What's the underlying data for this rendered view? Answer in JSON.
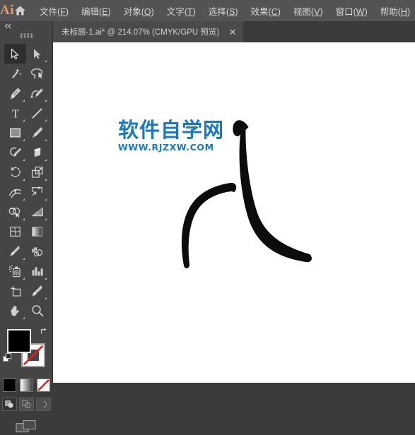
{
  "app": {
    "name": "Ai",
    "logo_color": "#e59b63",
    "home_icon": "home-icon"
  },
  "menubar": {
    "items": [
      {
        "label": "文件",
        "accel": "F"
      },
      {
        "label": "编辑",
        "accel": "E"
      },
      {
        "label": "对象",
        "accel": "O"
      },
      {
        "label": "文字",
        "accel": "T"
      },
      {
        "label": "选择",
        "accel": "S"
      },
      {
        "label": "效果",
        "accel": "C"
      },
      {
        "label": "视图",
        "accel": "V"
      },
      {
        "label": "窗口",
        "accel": "W"
      },
      {
        "label": "帮助",
        "accel": "H"
      }
    ]
  },
  "tabbar": {
    "tab_title": "未标题-1.ai* @ 214.07% (CMYK/GPU 预览)",
    "close_label": "✕"
  },
  "canvas": {
    "background": "#ffffff",
    "zoom_level": "214.07%",
    "watermark": {
      "text_cn": "软件自学网",
      "text_url": "WWW.RJZXW.COM",
      "color": "#1b78c2"
    },
    "artwork": {
      "stroke_color": "#000000",
      "description": "two tapered black brush strokes"
    }
  },
  "toolbar": {
    "collapse_label": "«",
    "tools": [
      {
        "name": "selection-tool",
        "label": "选择工具",
        "active": true,
        "corner": false
      },
      {
        "name": "direct-selection-tool",
        "label": "直接选择工具",
        "active": false,
        "corner": true
      },
      {
        "name": "magic-wand-tool",
        "label": "魔棒工具",
        "active": false,
        "corner": false
      },
      {
        "name": "lasso-tool",
        "label": "套索工具",
        "active": false,
        "corner": false
      },
      {
        "name": "pen-tool",
        "label": "钢笔工具",
        "active": false,
        "corner": true
      },
      {
        "name": "curvature-tool",
        "label": "曲率工具",
        "active": false,
        "corner": true
      },
      {
        "name": "type-tool",
        "label": "文字工具",
        "active": false,
        "corner": true
      },
      {
        "name": "line-segment-tool",
        "label": "直线段工具",
        "active": false,
        "corner": true
      },
      {
        "name": "rectangle-tool",
        "label": "矩形工具",
        "active": false,
        "corner": true
      },
      {
        "name": "paintbrush-tool",
        "label": "画笔工具",
        "active": false,
        "corner": true
      },
      {
        "name": "shaper-tool",
        "label": "Shaper 工具",
        "active": false,
        "corner": true
      },
      {
        "name": "eraser-tool",
        "label": "橡皮擦工具",
        "active": false,
        "corner": true
      },
      {
        "name": "rotate-tool",
        "label": "旋转工具",
        "active": false,
        "corner": true
      },
      {
        "name": "scale-tool",
        "label": "比例缩放工具",
        "active": false,
        "corner": true
      },
      {
        "name": "width-tool",
        "label": "宽度工具",
        "active": false,
        "corner": true
      },
      {
        "name": "free-transform-tool",
        "label": "自由变换工具",
        "active": false,
        "corner": true
      },
      {
        "name": "shape-builder-tool",
        "label": "形状生成器工具",
        "active": false,
        "corner": true
      },
      {
        "name": "perspective-grid-tool",
        "label": "透视网格工具",
        "active": false,
        "corner": true
      },
      {
        "name": "mesh-tool",
        "label": "网格工具",
        "active": false,
        "corner": false
      },
      {
        "name": "gradient-tool",
        "label": "渐变工具",
        "active": false,
        "corner": false
      },
      {
        "name": "eyedropper-tool",
        "label": "吸管工具",
        "active": false,
        "corner": true
      },
      {
        "name": "blend-tool",
        "label": "混合工具",
        "active": false,
        "corner": false
      },
      {
        "name": "symbol-sprayer-tool",
        "label": "符号喷枪工具",
        "active": false,
        "corner": true
      },
      {
        "name": "column-graph-tool",
        "label": "柱形图工具",
        "active": false,
        "corner": true
      },
      {
        "name": "artboard-tool",
        "label": "画板工具",
        "active": false,
        "corner": false
      },
      {
        "name": "slice-tool",
        "label": "切片工具",
        "active": false,
        "corner": true
      },
      {
        "name": "hand-tool",
        "label": "抓手工具",
        "active": false,
        "corner": true
      },
      {
        "name": "zoom-tool",
        "label": "缩放工具",
        "active": false,
        "corner": false
      }
    ],
    "swatches": {
      "fill_color": "#000000",
      "stroke_color": "none",
      "fill_label": "填色",
      "stroke_label": "描边",
      "swap_label": "互换填色和描边",
      "default_label": "默认填色和描边"
    },
    "color_modes": [
      {
        "name": "color-mode-button",
        "label": "颜色",
        "active": true
      },
      {
        "name": "gradient-mode-button",
        "label": "渐变",
        "active": false
      },
      {
        "name": "none-mode-button",
        "label": "无",
        "active": false
      }
    ],
    "draw_modes": [
      {
        "name": "draw-normal-button",
        "label": "正常绘图",
        "active": true
      },
      {
        "name": "draw-behind-button",
        "label": "背面绘图",
        "active": false
      },
      {
        "name": "draw-inside-button",
        "label": "内部绘图",
        "active": false
      }
    ],
    "screen_mode": {
      "name": "screen-mode-button",
      "label": "更改屏幕模式"
    }
  }
}
